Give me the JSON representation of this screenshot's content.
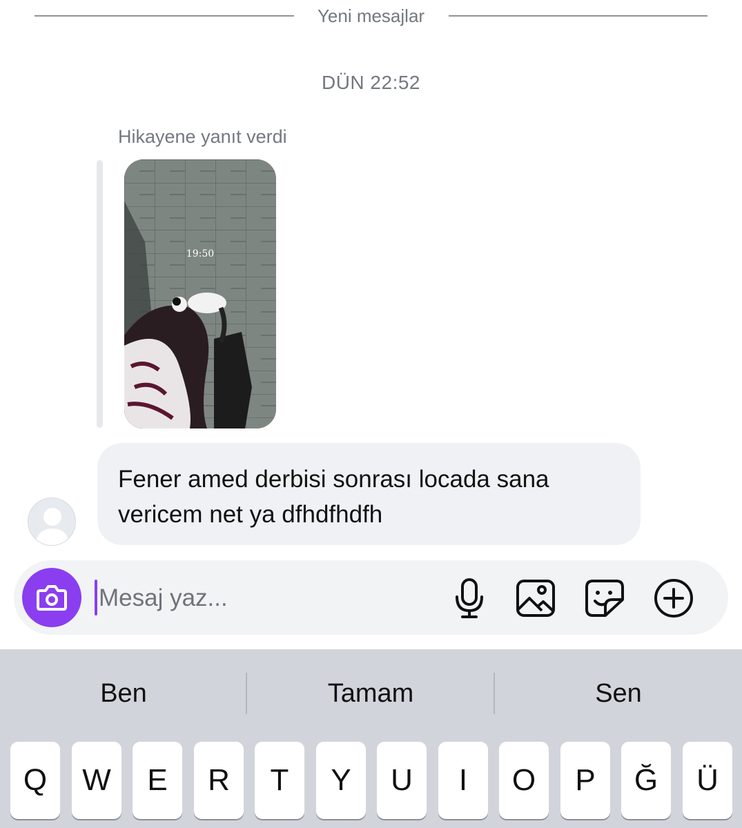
{
  "chat": {
    "new_messages_label": "Yeni mesajlar",
    "timestamp": "DÜN 22:52",
    "story_reply_label": "Hikayene yanıt verdi",
    "story_time": "19:50",
    "message_lines": [
      "Fener amed derbisi sonrası locada sana",
      "vericem net ya dfhdfhdfh"
    ]
  },
  "composer": {
    "placeholder": "Mesaj yaz...",
    "accent_color": "#8a3ef0",
    "icons": [
      "camera-icon",
      "microphone-icon",
      "gallery-icon",
      "sticker-icon",
      "plus-icon"
    ]
  },
  "keyboard": {
    "suggestions": [
      "Ben",
      "Tamam",
      "Sen"
    ],
    "keys": [
      "Q",
      "W",
      "E",
      "R",
      "T",
      "Y",
      "U",
      "I",
      "O",
      "P",
      "Ğ",
      "Ü"
    ]
  }
}
